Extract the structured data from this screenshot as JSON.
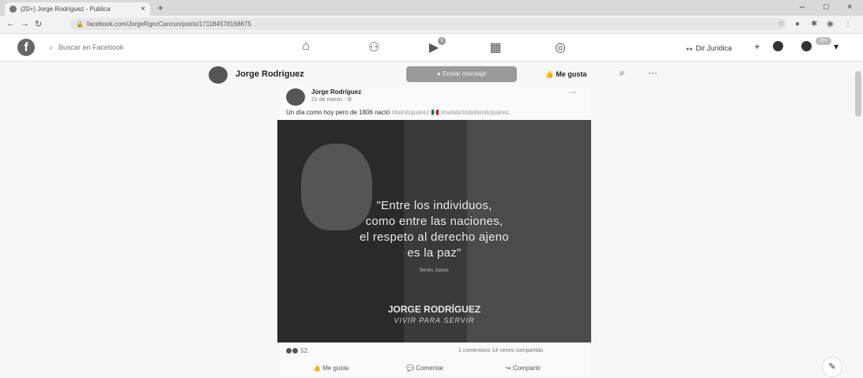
{
  "browser": {
    "tab_title": "(20+) Jorge Rodríguez - Publica",
    "tab_close": "×",
    "new_tab": "+",
    "url": "facebook.com/JorgeRgezCancun/posts/171184578168675",
    "window_controls": [
      "–",
      "□",
      "×"
    ]
  },
  "fb": {
    "logo": "f",
    "search_placeholder": "Buscar en Facebook",
    "nav_icons": [
      "home-icon",
      "friends-icon",
      "watch-icon",
      "marketplace-icon",
      "groups-icon"
    ],
    "watch_badge": "9",
    "page_name": "Dir Jurídica",
    "notif_badge": "20+"
  },
  "page": {
    "name": "Jorge Rodríguez",
    "send_message": "Enviar mensaje",
    "like": "Me gusta",
    "more": "···"
  },
  "post": {
    "author": "Jorge Rodríguez",
    "date": "21 de marzo · ⚙",
    "more": "···",
    "text_plain": "Un día como hoy pero de 1806 nació ",
    "text_tags": "#benitojuárez 🇲🇽 #nataliciodebenitojuárez.",
    "image": {
      "quote_line1": "\"Entre los individuos,",
      "quote_line2": "como entre las naciones,",
      "quote_line3": "el respeto al derecho ajeno",
      "quote_line4": "es la paz\"",
      "quote_author": "Benito Juárez",
      "brand": "JORGE RODRÍGUEZ",
      "slogan": "VIVIR PARA SERVIR"
    },
    "reaction_count": "52",
    "comments_shares": "1 comentario  14 veces compartido",
    "action_like": "Me gusta",
    "action_comment": "Comentar",
    "action_share": "Compartir"
  }
}
